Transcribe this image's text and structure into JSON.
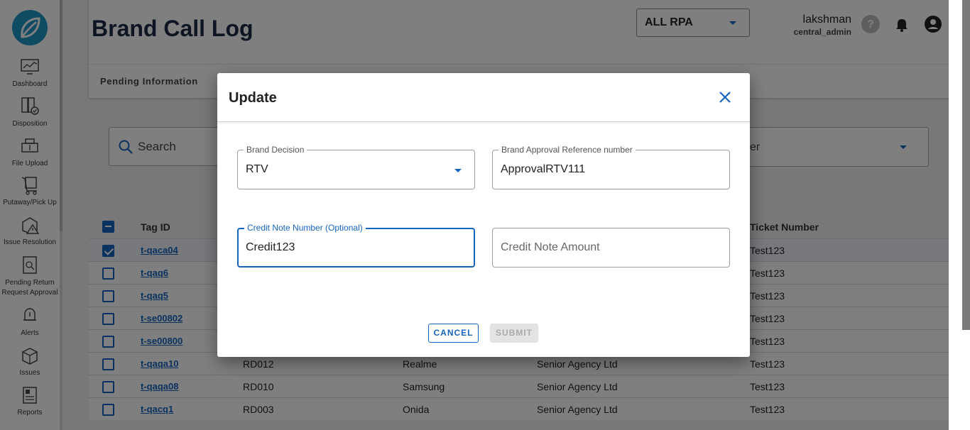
{
  "sidebar": {
    "items": [
      {
        "label": "Dashboard",
        "icon": "dashboard-icon"
      },
      {
        "label": "Disposition",
        "icon": "disposition-icon"
      },
      {
        "label": "File Upload",
        "icon": "file-upload-icon"
      },
      {
        "label": "Putaway/Pick Up",
        "icon": "putaway-icon"
      },
      {
        "label": "Issue Resolution",
        "icon": "issue-resolution-icon"
      },
      {
        "label": "Pending Return",
        "label2": "Request Approval",
        "icon": "pending-return-icon"
      },
      {
        "label": "Alerts",
        "icon": "alerts-icon"
      },
      {
        "label": "Issues",
        "icon": "issues-icon"
      },
      {
        "label": "Reports",
        "icon": "reports-icon"
      }
    ]
  },
  "header": {
    "title": "Brand Call Log",
    "rpa_select": "ALL RPA",
    "user_name": "lakshman",
    "user_role": "central_admin",
    "tabs": [
      "Pending Information"
    ]
  },
  "toolbar": {
    "search_placeholder": "Search",
    "filter_partial": "er"
  },
  "table": {
    "columns": {
      "tag_id": "Tag ID",
      "ticket_number": "Ticket Number"
    },
    "rows": [
      {
        "tag_id": "t-qaca04",
        "ref": "",
        "brand": "",
        "agency": "",
        "ticket": "Test123",
        "checked": true
      },
      {
        "tag_id": "t-qaq6",
        "ref": "",
        "brand": "",
        "agency": "",
        "ticket": "Test123",
        "checked": false
      },
      {
        "tag_id": "t-qaq5",
        "ref": "",
        "brand": "",
        "agency": "",
        "ticket": "Test123",
        "checked": false
      },
      {
        "tag_id": "t-se00802",
        "ref": "",
        "brand": "",
        "agency": "",
        "ticket": "Test123",
        "checked": false
      },
      {
        "tag_id": "t-se00800",
        "ref": "",
        "brand": "",
        "agency": "",
        "ticket": "Test123",
        "checked": false
      },
      {
        "tag_id": "t-qaqa10",
        "ref": "RD012",
        "brand": "Realme",
        "agency": "Senior Agency Ltd",
        "ticket": "Test123",
        "checked": false
      },
      {
        "tag_id": "t-qaqa08",
        "ref": "RD010",
        "brand": "Samsung",
        "agency": "Senior Agency Ltd",
        "ticket": "Test123",
        "checked": false
      },
      {
        "tag_id": "t-qacq1",
        "ref": "RD003",
        "brand": "Onida",
        "agency": "Senior Agency Ltd",
        "ticket": "Test123",
        "checked": false
      }
    ]
  },
  "dialog": {
    "title": "Update",
    "brand_decision_label": "Brand Decision",
    "brand_decision_value": "RTV",
    "approval_ref_label": "Brand Approval Reference number",
    "approval_ref_value": "ApprovalRTV111",
    "credit_note_number_label": "Credit Note Number (Optional)",
    "credit_note_number_value": "Credit123",
    "credit_note_amount_placeholder": "Credit Note Amount",
    "cancel_label": "CANCEL",
    "submit_label": "SUBMIT"
  },
  "colors": {
    "accent": "#1565c0",
    "logo": "#2196c9",
    "title": "#1c2a44"
  }
}
